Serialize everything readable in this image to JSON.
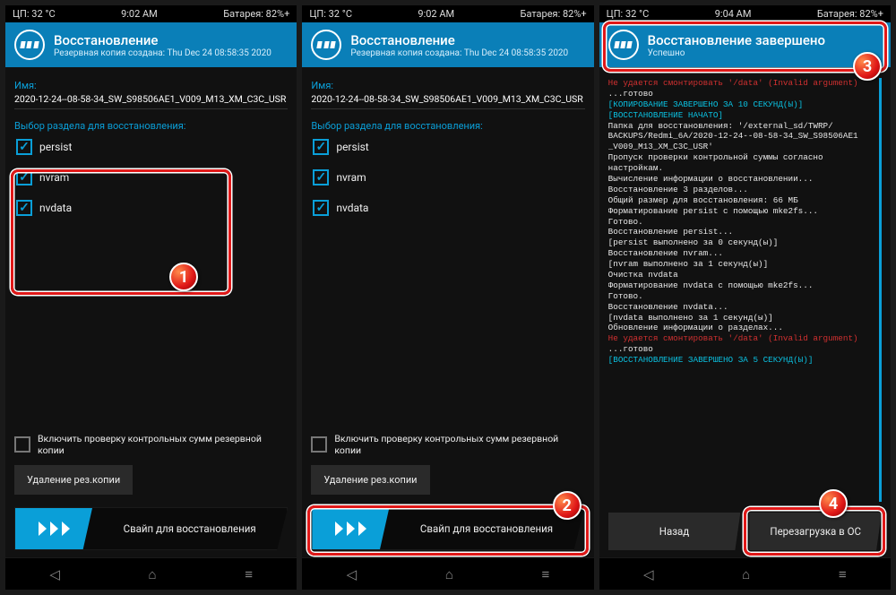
{
  "statusbar": {
    "cpu": "ЦП: 32 °C",
    "time12": "9:02 AM",
    "time3": "9:04 AM",
    "battery": "Батарея: 82%+"
  },
  "header": {
    "title": "Восстановление",
    "subtitle": "Резервная копия создана: Thu Dec 24 08:58:35 2020",
    "title_done": "Восстановление завершено",
    "subtitle_done": "Успешно"
  },
  "body": {
    "name_label": "Имя:",
    "name_value": "2020-12-24--08-58-34_SW_S98506AE1_V009_M13_XM_C3C_USR",
    "section_label": "Выбор раздела для восстановления:",
    "partitions": [
      "persist",
      "nvram",
      "nvdata"
    ],
    "md5_label": "Включить проверку контрольных сумм резервной копии",
    "delete_btn": "Удаление рез.копии",
    "swipe_label": "Свайп для восстановления",
    "back_btn": "Назад",
    "reboot_btn": "Перезагрузка в ОС"
  },
  "log": {
    "l1": "Не удается смонтировать '/data' (Invalid argument)",
    "l2": "...готово",
    "l3": "[КОПИРОВАНИЕ ЗАВЕРШЕНО ЗА 10 СЕКУНД(Ы)]",
    "l4": "[ВОССТАНОВЛЕНИЕ НАЧАТО]",
    "l5": "Папка для восстановления: '/external_sd/TWRP/",
    "l6": "BACKUPS/Redmi_6A/2020-12-24--08-58-34_SW_S98506AE1",
    "l7": "_V009_M13_XM_C3C_USR'",
    "l8": "Пропуск проверки контрольной суммы согласно",
    "l9": "настройкам.",
    "l10": "Вычисление информации о восстановлении...",
    "l11": "Восстановление 3 разделов...",
    "l12": "Общий размер для восстановления: 66 МБ",
    "l13": "Форматирование persist с помощью mke2fs...",
    "l14": "Готово.",
    "l15": "Восстановление persist...",
    "l16": "[persist выполнено за 0 секунд(ы)]",
    "l17": "Восстановление nvram...",
    "l18": "[nvram выполнено за 1 секунд(ы)]",
    "l19": "Очистка nvdata",
    "l20": "Форматирование nvdata с помощью mke2fs...",
    "l21": "Готово.",
    "l22": "Восстановление nvdata...",
    "l23": "[nvdata выполнено за 1 секунд(ы)]",
    "l24": "Обновление информации о разделах...",
    "l25": "Не удается смонтировать '/data' (Invalid argument)",
    "l26": "...готово",
    "l27": "[ВОССТАНОВЛЕНИЕ ЗАВЕРШЕНО ЗА 5 СЕКУНД(Ы)]"
  },
  "badges": {
    "b1": "1",
    "b2": "2",
    "b3": "3",
    "b4": "4"
  }
}
